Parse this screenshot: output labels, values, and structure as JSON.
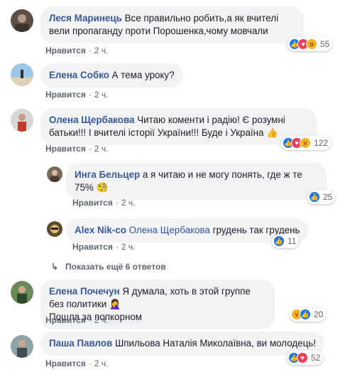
{
  "like_label": "Нравится",
  "comments": [
    {
      "author": "Леся Маринець",
      "text": "Все правильно робить,а як вчителі вели пропаганду проти Порошенка,чому мовчали",
      "time": "2 ч.",
      "reactions": [
        "like",
        "love",
        "wow"
      ],
      "count": "55"
    },
    {
      "author": "Елена Собко",
      "text": "А тема уроку?",
      "time": "2 ч."
    },
    {
      "author": "Олена Щербакова",
      "text": "Читаю коменти і радію! Є розумні батьки!!! І вчителі історії України!!! Буде і Україна",
      "text_emoji": "👍",
      "time": "2 ч.",
      "reactions": [
        "like",
        "love",
        "haha"
      ],
      "count": "122"
    },
    {
      "author": "Инга Бельцер",
      "text": "а я читаю и не могу понять, где ж те 75%",
      "text_emoji": "🧐",
      "time": "2 ч.",
      "reactions": [
        "like"
      ],
      "count": "25"
    },
    {
      "author": "Alex Nik-co",
      "mention": "Олена Щербакова",
      "text": "грудень так грудень",
      "time": "2 ч.",
      "reactions": [
        "like"
      ],
      "count": "11"
    },
    {
      "author": "Елена Почечун",
      "text": "Я думала, хоть в этой группе без политики",
      "text_emoji": "🤦‍♀️",
      "text2": "Пошла за попкорном",
      "time": "2 ч.",
      "reactions": [
        "haha",
        "like"
      ],
      "count": "20"
    },
    {
      "author": "Паша Павлов",
      "text": "Шпильова Наталія Миколаївна, ви молодець!",
      "time": "2 ч.",
      "reactions": [
        "like",
        "love"
      ],
      "count": "52"
    }
  ],
  "show_more": "Показать ещё 6 ответов",
  "colors": {
    "link": "#385898",
    "bubble": "#f2f3f5",
    "like": "#1877f2",
    "love": "#f33e58",
    "haha": "#f7b125"
  }
}
